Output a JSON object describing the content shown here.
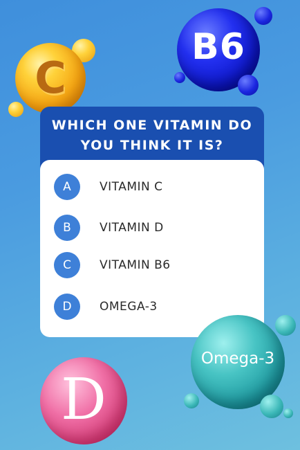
{
  "question": {
    "line1": "WHICH ONE VITAMIN DO",
    "line2": "YOU THINK IT IS?"
  },
  "options": [
    {
      "letter": "A",
      "label": "VITAMIN C"
    },
    {
      "letter": "B",
      "label": "VITAMIN D"
    },
    {
      "letter": "C",
      "label": "VITAMIN B6"
    },
    {
      "letter": "D",
      "label": "OMEGA-3"
    }
  ],
  "decorations": {
    "vitamin_c_orb": "C",
    "vitamin_b6_orb": "B6",
    "omega_orb": "Omega-3",
    "vitamin_d_orb": "D"
  },
  "colors": {
    "header_bg": "#1a4fb0",
    "badge_bg": "#3e80d8",
    "card_bg": "#ffffff"
  }
}
